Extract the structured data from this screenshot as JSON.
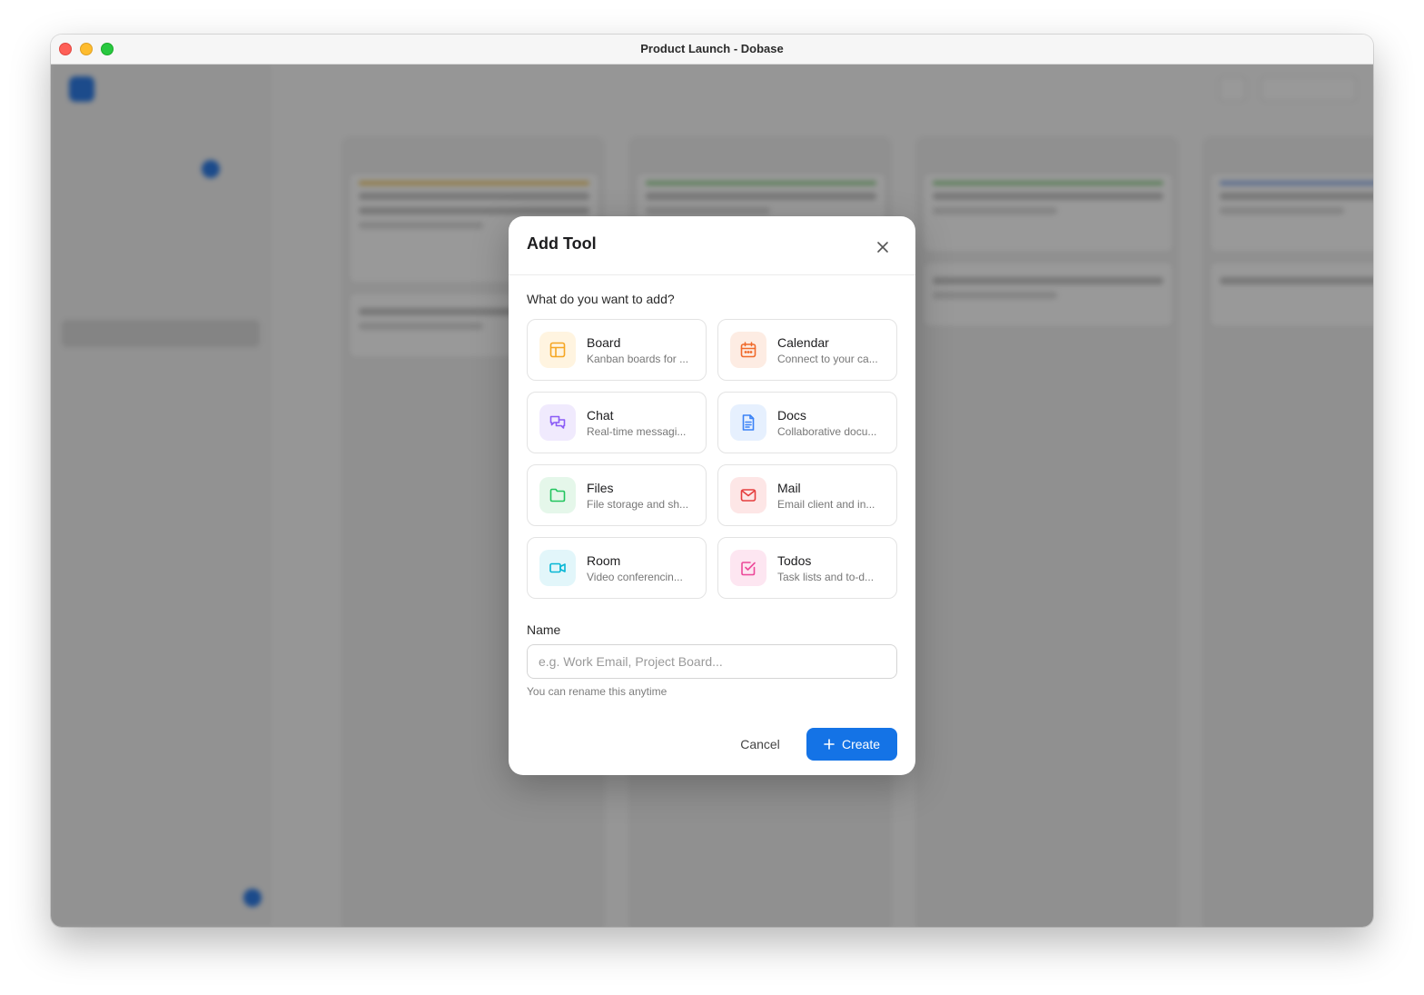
{
  "window": {
    "title": "Product Launch - Dobase"
  },
  "modal": {
    "title": "Add Tool",
    "section_label": "What do you want to add?",
    "tools": [
      {
        "name": "Board",
        "desc": "Kanban boards for ...",
        "icon": "board-icon",
        "color": "#f5a623",
        "bg": "#fff4e0"
      },
      {
        "name": "Calendar",
        "desc": "Connect to your ca...",
        "icon": "calendar-icon",
        "color": "#f06a2b",
        "bg": "#fdece3"
      },
      {
        "name": "Chat",
        "desc": "Real-time messagi...",
        "icon": "chat-icon",
        "color": "#8b5cf6",
        "bg": "#f0eafd"
      },
      {
        "name": "Docs",
        "desc": "Collaborative docu...",
        "icon": "docs-icon",
        "color": "#3b82f6",
        "bg": "#e6f0fe"
      },
      {
        "name": "Files",
        "desc": "File storage and sh...",
        "icon": "folder-icon",
        "color": "#22c55e",
        "bg": "#e5f7ea"
      },
      {
        "name": "Mail",
        "desc": "Email client and in...",
        "icon": "mail-icon",
        "color": "#e53e3e",
        "bg": "#fde6e6"
      },
      {
        "name": "Room",
        "desc": "Video conferencin...",
        "icon": "video-icon",
        "color": "#06b6d4",
        "bg": "#e2f6fa"
      },
      {
        "name": "Todos",
        "desc": "Task lists and to-d...",
        "icon": "todo-check-icon",
        "color": "#ec4899",
        "bg": "#fde6f1"
      }
    ],
    "name_label": "Name",
    "name_value": "",
    "name_placeholder": "e.g. Work Email, Project Board...",
    "hint": "You can rename this anytime",
    "cancel_label": "Cancel",
    "create_label": "Create",
    "accent": "#1473e6"
  }
}
